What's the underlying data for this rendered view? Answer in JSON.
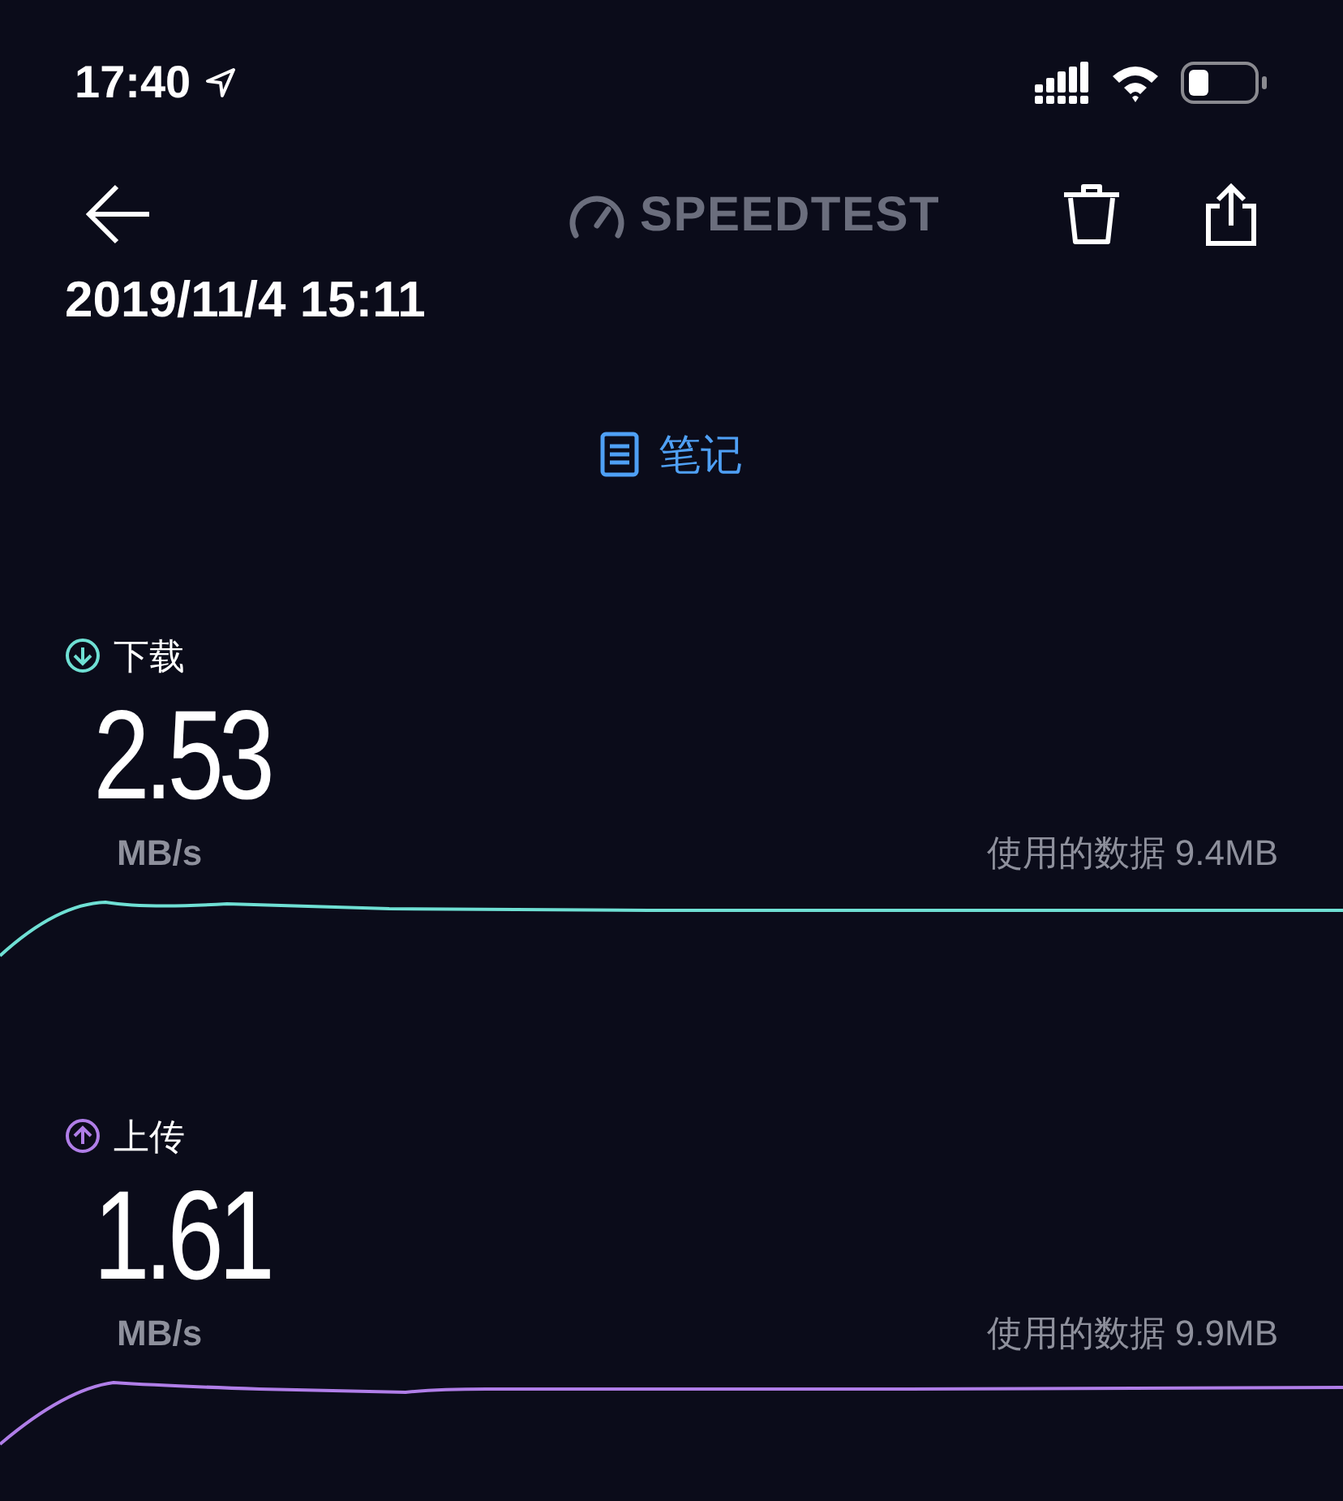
{
  "status_bar": {
    "time": "17:40"
  },
  "header": {
    "logo_text": "SPEEDTEST"
  },
  "date": "2019/11/4 15:11",
  "note_link": "笔记",
  "metrics": [
    {
      "kind": "download",
      "label": "下载",
      "value": "2.53",
      "unit": "MB/s",
      "data_used": "使用的数据 9.4MB",
      "color": "#6fe0d4"
    },
    {
      "kind": "upload",
      "label": "上传",
      "value": "1.61",
      "unit": "MB/s",
      "data_used": "使用的数据 9.9MB",
      "color": "#b07ee8"
    }
  ]
}
